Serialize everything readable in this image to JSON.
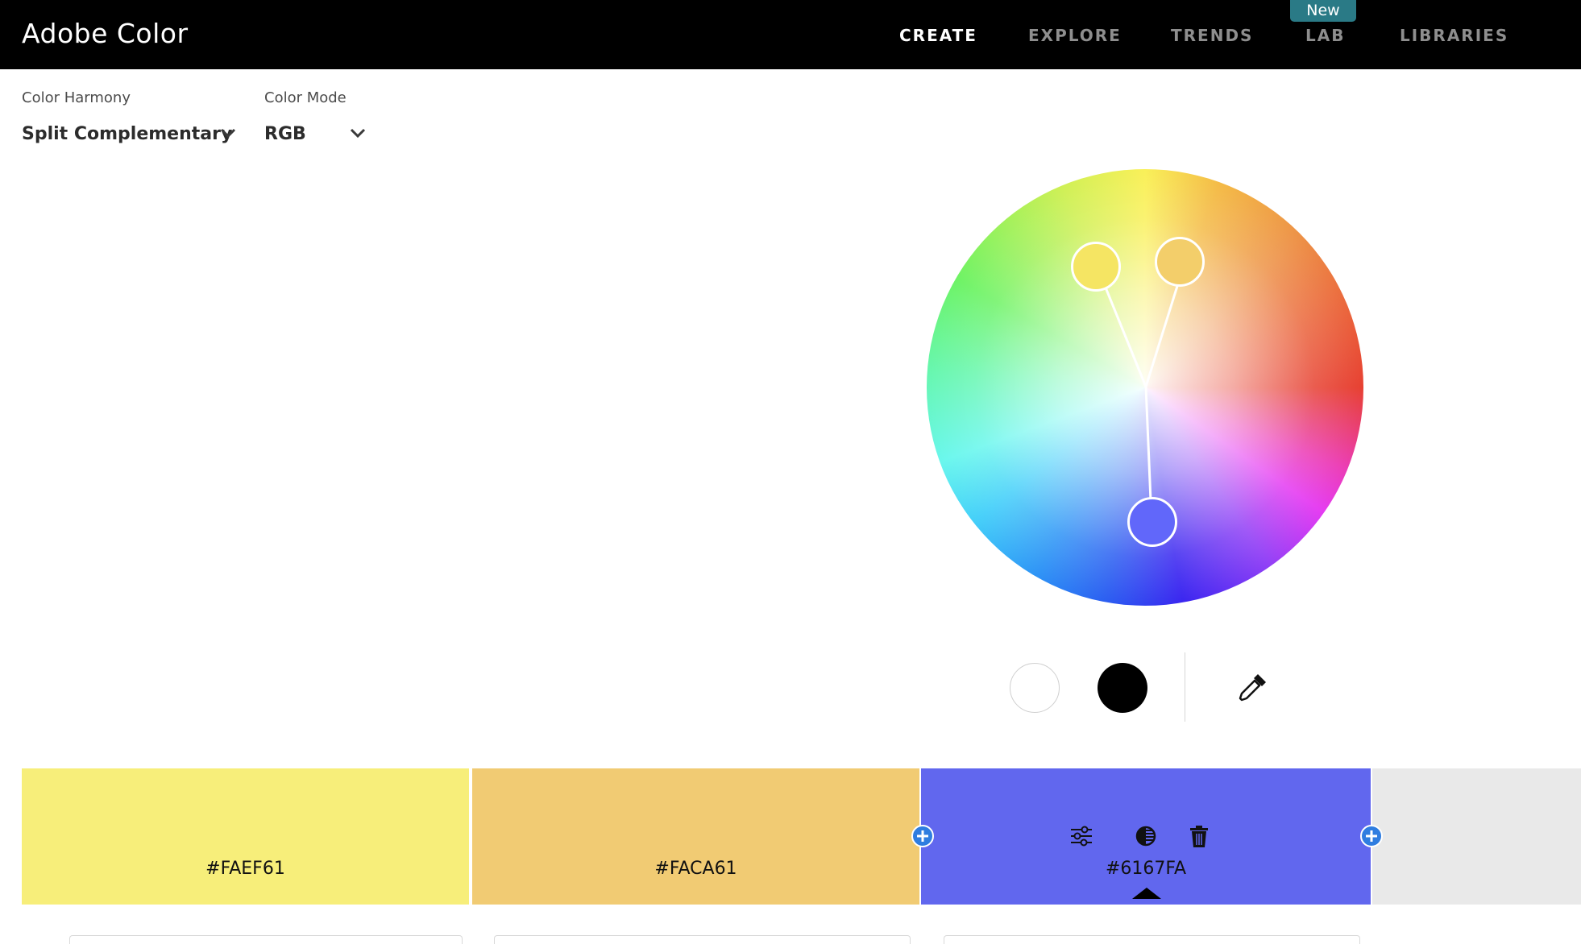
{
  "app": {
    "title": "Adobe Color"
  },
  "nav": {
    "items": [
      {
        "label": "CREATE",
        "active": true
      },
      {
        "label": "EXPLORE",
        "active": false
      },
      {
        "label": "TRENDS",
        "active": false
      },
      {
        "label": "LAB",
        "active": false,
        "badge": "New"
      },
      {
        "label": "LIBRARIES",
        "active": false
      }
    ]
  },
  "controls": {
    "harmony_label": "Color Harmony",
    "harmony_value": "Split Complementary",
    "mode_label": "Color Mode",
    "mode_value": "RGB"
  },
  "wheel": {
    "base_colors": [
      "#F5E563",
      "#F3CE6A",
      "#6167FA"
    ]
  },
  "picker": {
    "icons": [
      "white-swatch",
      "black-swatch",
      "eyedropper-icon"
    ]
  },
  "palette": {
    "swatches": [
      {
        "hex": "#FAEF61",
        "color": "#f7ee7a"
      },
      {
        "hex": "#FACA61",
        "color": "#f1cb73"
      },
      {
        "hex": "#6167FA",
        "color": "#6167ee",
        "selected": true
      }
    ],
    "empty_color": "#e9e9e9",
    "tools": [
      "sliders-icon",
      "contrast-icon",
      "trash-icon"
    ]
  }
}
